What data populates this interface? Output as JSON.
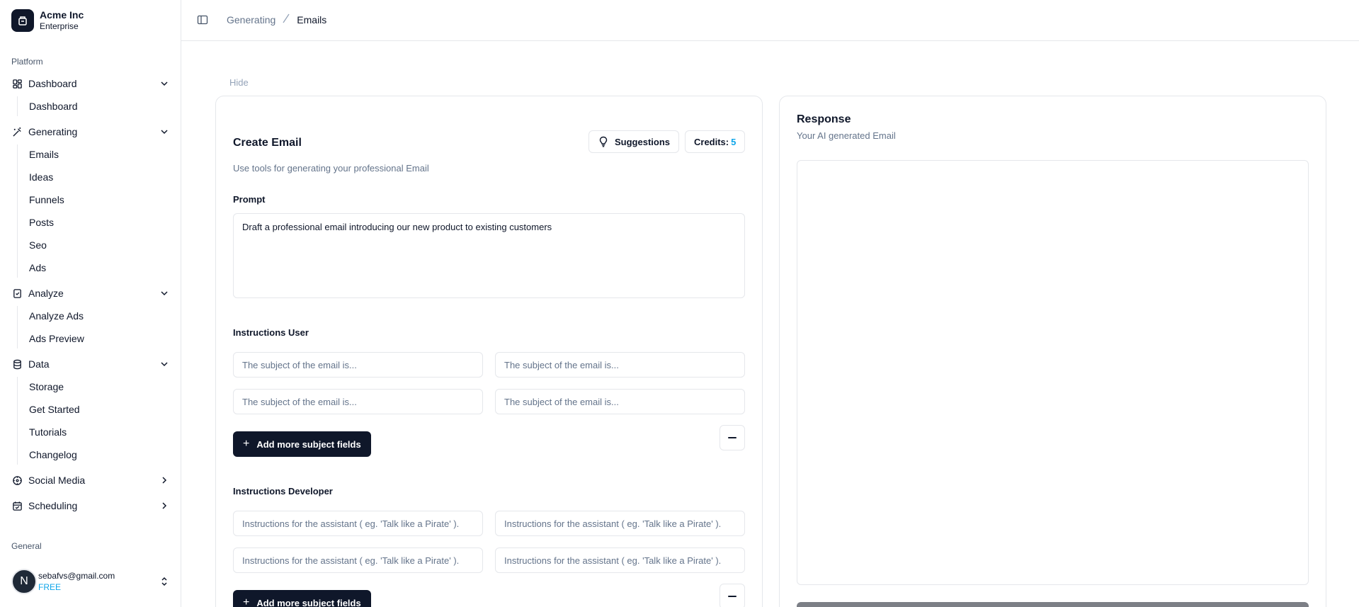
{
  "brand": {
    "name": "Acme Inc",
    "plan": "Enterprise"
  },
  "sidebar": {
    "platform_label": "Platform",
    "groups": [
      {
        "label": "Dashboard",
        "icon": "layout-grid-icon",
        "expanded": true,
        "items": [
          "Dashboard"
        ]
      },
      {
        "label": "Generating",
        "icon": "magic-wand-icon",
        "expanded": true,
        "items": [
          "Emails",
          "Ideas",
          "Funnels",
          "Posts",
          "Seo",
          "Ads"
        ]
      },
      {
        "label": "Analyze",
        "icon": "clipboard-check-icon",
        "expanded": true,
        "items": [
          "Analyze Ads",
          "Ads Preview"
        ]
      },
      {
        "label": "Data",
        "icon": "database-icon",
        "expanded": true,
        "items": [
          "Storage",
          "Get Started",
          "Tutorials",
          "Changelog"
        ]
      },
      {
        "label": "Social Media",
        "icon": "share-icon",
        "expanded": false,
        "items": []
      },
      {
        "label": "Scheduling",
        "icon": "calendar-check-icon",
        "expanded": false,
        "items": []
      }
    ],
    "general_label": "General",
    "user": {
      "initial": "N",
      "email": "sebafvs@gmail.com",
      "plan": "FREE"
    }
  },
  "header": {
    "breadcrumb": {
      "parent": "Generating",
      "current": "Emails"
    }
  },
  "main": {
    "hide_label": "Hide",
    "create": {
      "title": "Create Email",
      "subtitle": "Use tools for generating your professional Email",
      "suggestions_label": "Suggestions",
      "credits_label": "Credits:",
      "credits_value": "5",
      "prompt_label": "Prompt",
      "prompt_value": "Draft a professional email introducing our new product to existing customers",
      "instructions_user_label": "Instructions User",
      "subject_placeholder": "The subject of the email is...",
      "add_subject_label": "Add more subject fields",
      "instructions_dev_label": "Instructions Developer",
      "dev_placeholder": "Instructions for the assistant ( eg. 'Talk like a Pirate' )."
    },
    "response": {
      "title": "Response",
      "subtitle": "Your AI generated Email"
    }
  },
  "colors": {
    "accent": "#0ea5e9",
    "primary": "#0f172a",
    "border": "#e5e7eb",
    "muted": "#64748b"
  }
}
